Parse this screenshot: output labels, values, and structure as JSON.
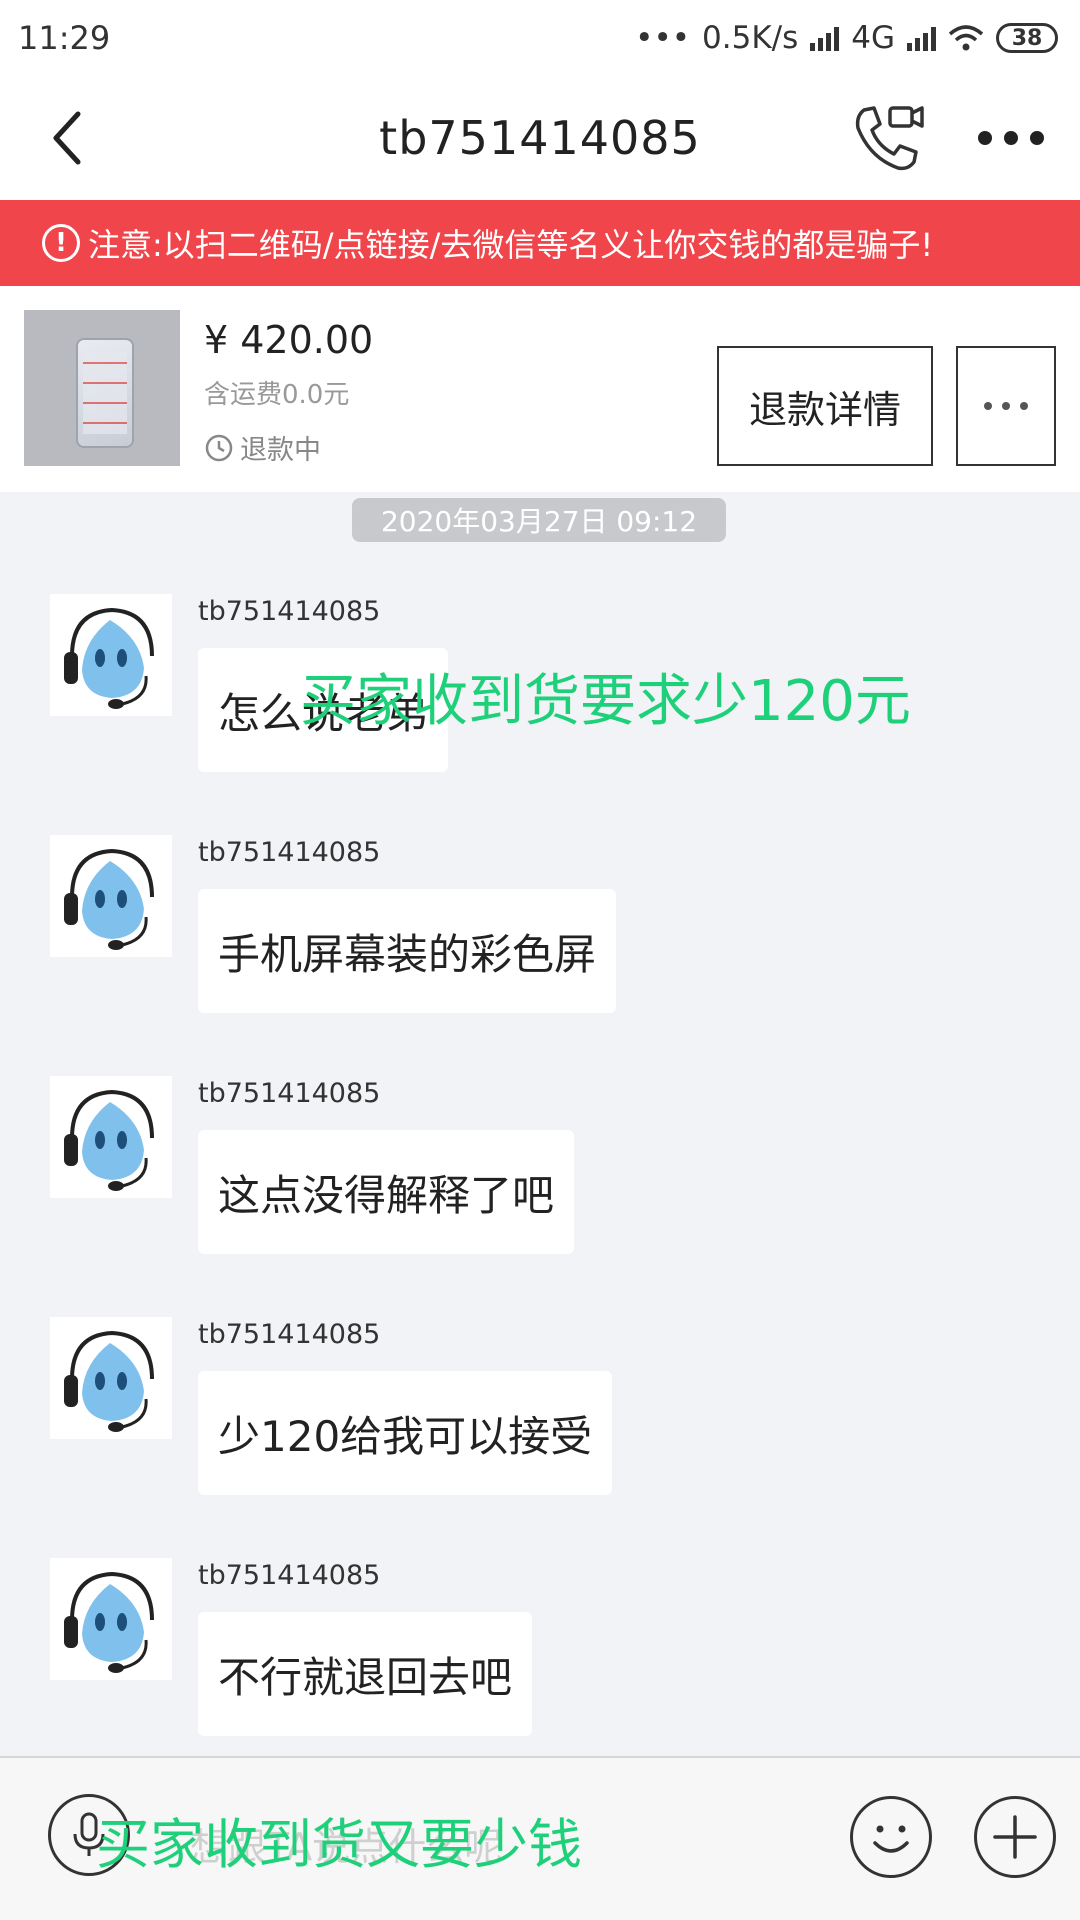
{
  "status_bar": {
    "time": "11:29",
    "network_speed": "0.5K/s",
    "network_type": "4G",
    "battery": "38"
  },
  "header": {
    "title": "tb751414085"
  },
  "warning": {
    "text": "注意:以扫二维码/点链接/去微信等名义让你交钱的都是骗子!"
  },
  "product": {
    "price": "¥ 420.00",
    "shipping": "含运费0.0元",
    "status": "退款中",
    "refund_button": "退款详情"
  },
  "chat": {
    "timestamp": "2020年03月27日 09:12",
    "messages": [
      {
        "sender": "tb751414085",
        "text": "怎么说老弟"
      },
      {
        "sender": "tb751414085",
        "text": "手机屏幕装的彩色屏"
      },
      {
        "sender": "tb751414085",
        "text": "这点没得解释了吧"
      },
      {
        "sender": "tb751414085",
        "text": "少120给我可以接受"
      },
      {
        "sender": "tb751414085",
        "text": "不行就退回去吧"
      }
    ]
  },
  "annotations": {
    "top": "买家收到货要求少120元",
    "bottom": "买家收到货又要少钱"
  },
  "input_bar": {
    "placeholder": "想跟TA说点什么呢"
  },
  "colors": {
    "warning_bg": "#f0454a",
    "chat_bg": "#f1f3f6",
    "annotation": "#1fd07a"
  }
}
